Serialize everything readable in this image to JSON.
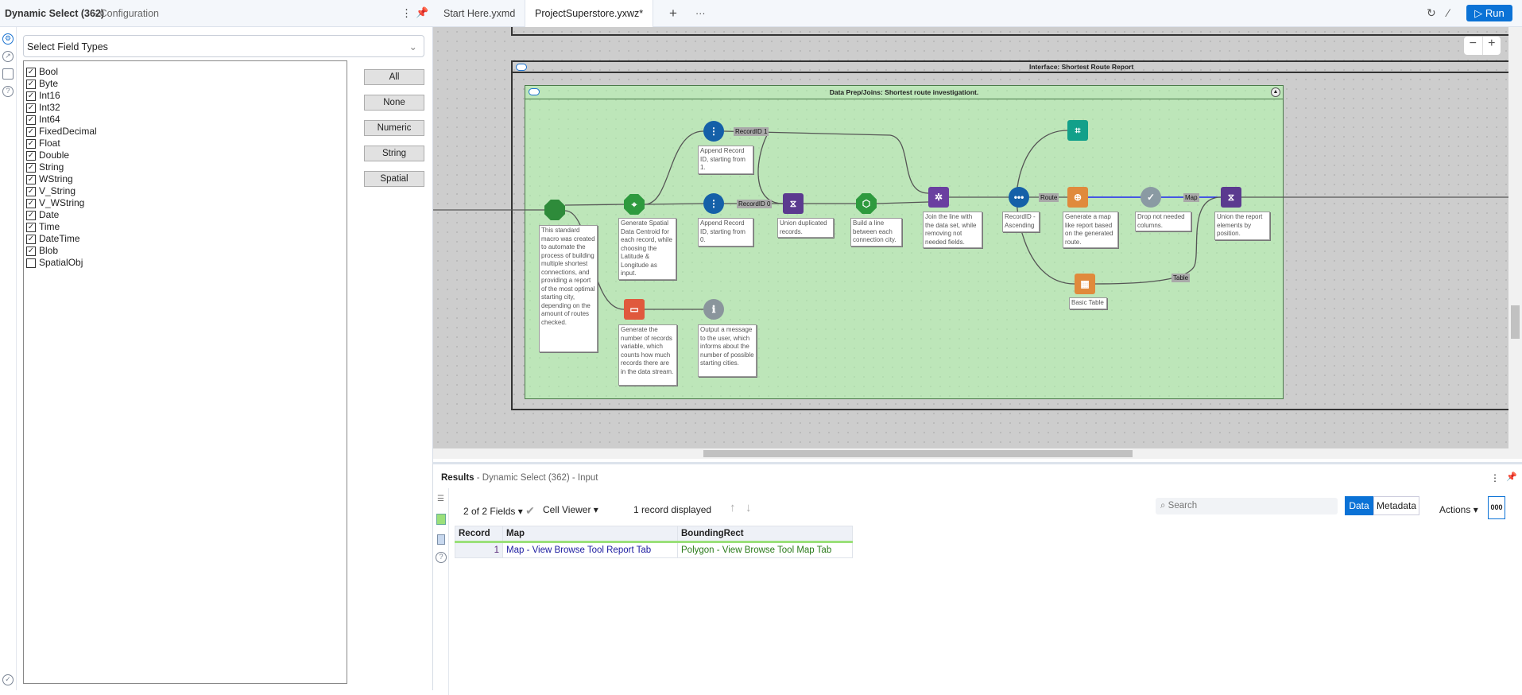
{
  "config": {
    "title": "Dynamic Select (362)",
    "subtitle": "- Configuration",
    "dropdown": "Select Field Types",
    "fields": [
      {
        "label": "Bool",
        "checked": true
      },
      {
        "label": "Byte",
        "checked": true
      },
      {
        "label": "Int16",
        "checked": true
      },
      {
        "label": "Int32",
        "checked": true
      },
      {
        "label": "Int64",
        "checked": true
      },
      {
        "label": "FixedDecimal",
        "checked": true
      },
      {
        "label": "Float",
        "checked": true
      },
      {
        "label": "Double",
        "checked": true
      },
      {
        "label": "String",
        "checked": true
      },
      {
        "label": "WString",
        "checked": true
      },
      {
        "label": "V_String",
        "checked": true
      },
      {
        "label": "V_WString",
        "checked": true
      },
      {
        "label": "Date",
        "checked": true
      },
      {
        "label": "Time",
        "checked": true
      },
      {
        "label": "DateTime",
        "checked": true
      },
      {
        "label": "Blob",
        "checked": true
      },
      {
        "label": "SpatialObj",
        "checked": false
      }
    ],
    "buttons": [
      "All",
      "None",
      "Numeric",
      "String",
      "Spatial"
    ]
  },
  "tabs": [
    {
      "label": "Start Here.yxmd"
    },
    {
      "label": "ProjectSuperstore.yxwz*"
    }
  ],
  "toolbar": {
    "run": "Run",
    "accent": "#0b72d6"
  },
  "canvas": {
    "interface_title": "Interface: Shortest Route Report",
    "container_title": "Data Prep/Joins: Shortest route investigationt.",
    "annotations": {
      "macro": "This standard macro was created to automate the process of building multiple shortest connections, and providing a report of the most optimal starting city, depending on the amount of routes checked.",
      "centroid": "Generate Spatial Data Centroid for each record, while choosing the Latitude & Longitude as input.",
      "rid1": "Append Record ID, starting from 1.",
      "rid0": "Append Record ID, starting from 0.",
      "union": "Union duplicated records.",
      "build": "Build a line between each connection city.",
      "join": "Join the line with the data set, while removing not needed fields.",
      "sort": "RecordID - Ascending",
      "count": "Generate the number of records variable, which counts how much records there are in the data stream.",
      "message": "Output a message to the user, which informs about the number of possible starting cities.",
      "report": "Generate a map like report based on the generated route.",
      "select": "Drop not needed columns.",
      "layout": "Union the report elements by position.",
      "table": "Basic Table"
    },
    "wire_labels": {
      "rid1": "RecordID 1",
      "rid0": "RecordID 0",
      "route": "Route",
      "map": "Map",
      "table": "Table"
    }
  },
  "results": {
    "title": "Results",
    "subtitle": "- Dynamic Select (362) - Input",
    "fields": "2 of 2 Fields",
    "viewer": "Cell Viewer",
    "records": "1 record displayed",
    "search_placeholder": "Search",
    "data": "Data",
    "metadata": "Metadata",
    "actions": "Actions",
    "columns": [
      "Record",
      "Map",
      "BoundingRect"
    ],
    "rows": [
      [
        "1",
        "Map - View Browse Tool Report Tab",
        "Polygon - View Browse Tool Map Tab"
      ]
    ]
  }
}
